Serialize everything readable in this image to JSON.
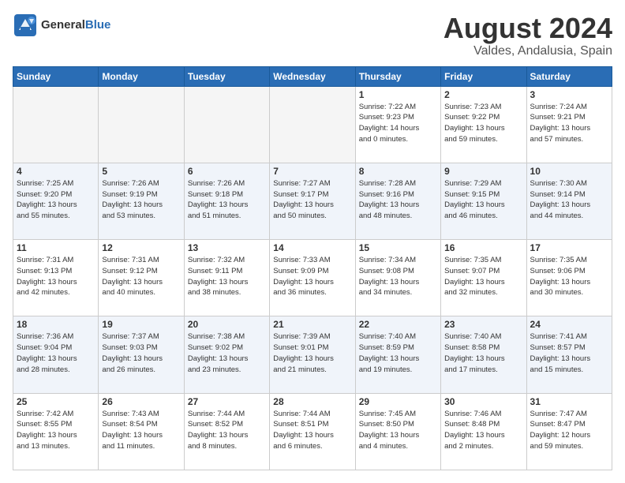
{
  "logo": {
    "text_general": "General",
    "text_blue": "Blue"
  },
  "header": {
    "month_title": "August 2024",
    "subtitle": "Valdes, Andalusia, Spain"
  },
  "weekdays": [
    "Sunday",
    "Monday",
    "Tuesday",
    "Wednesday",
    "Thursday",
    "Friday",
    "Saturday"
  ],
  "weeks": [
    [
      {
        "day": "",
        "info": "",
        "empty": true
      },
      {
        "day": "",
        "info": "",
        "empty": true
      },
      {
        "day": "",
        "info": "",
        "empty": true
      },
      {
        "day": "",
        "info": "",
        "empty": true
      },
      {
        "day": "1",
        "info": "Sunrise: 7:22 AM\nSunset: 9:23 PM\nDaylight: 14 hours\nand 0 minutes.",
        "empty": false
      },
      {
        "day": "2",
        "info": "Sunrise: 7:23 AM\nSunset: 9:22 PM\nDaylight: 13 hours\nand 59 minutes.",
        "empty": false
      },
      {
        "day": "3",
        "info": "Sunrise: 7:24 AM\nSunset: 9:21 PM\nDaylight: 13 hours\nand 57 minutes.",
        "empty": false
      }
    ],
    [
      {
        "day": "4",
        "info": "Sunrise: 7:25 AM\nSunset: 9:20 PM\nDaylight: 13 hours\nand 55 minutes.",
        "empty": false
      },
      {
        "day": "5",
        "info": "Sunrise: 7:26 AM\nSunset: 9:19 PM\nDaylight: 13 hours\nand 53 minutes.",
        "empty": false
      },
      {
        "day": "6",
        "info": "Sunrise: 7:26 AM\nSunset: 9:18 PM\nDaylight: 13 hours\nand 51 minutes.",
        "empty": false
      },
      {
        "day": "7",
        "info": "Sunrise: 7:27 AM\nSunset: 9:17 PM\nDaylight: 13 hours\nand 50 minutes.",
        "empty": false
      },
      {
        "day": "8",
        "info": "Sunrise: 7:28 AM\nSunset: 9:16 PM\nDaylight: 13 hours\nand 48 minutes.",
        "empty": false
      },
      {
        "day": "9",
        "info": "Sunrise: 7:29 AM\nSunset: 9:15 PM\nDaylight: 13 hours\nand 46 minutes.",
        "empty": false
      },
      {
        "day": "10",
        "info": "Sunrise: 7:30 AM\nSunset: 9:14 PM\nDaylight: 13 hours\nand 44 minutes.",
        "empty": false
      }
    ],
    [
      {
        "day": "11",
        "info": "Sunrise: 7:31 AM\nSunset: 9:13 PM\nDaylight: 13 hours\nand 42 minutes.",
        "empty": false
      },
      {
        "day": "12",
        "info": "Sunrise: 7:31 AM\nSunset: 9:12 PM\nDaylight: 13 hours\nand 40 minutes.",
        "empty": false
      },
      {
        "day": "13",
        "info": "Sunrise: 7:32 AM\nSunset: 9:11 PM\nDaylight: 13 hours\nand 38 minutes.",
        "empty": false
      },
      {
        "day": "14",
        "info": "Sunrise: 7:33 AM\nSunset: 9:09 PM\nDaylight: 13 hours\nand 36 minutes.",
        "empty": false
      },
      {
        "day": "15",
        "info": "Sunrise: 7:34 AM\nSunset: 9:08 PM\nDaylight: 13 hours\nand 34 minutes.",
        "empty": false
      },
      {
        "day": "16",
        "info": "Sunrise: 7:35 AM\nSunset: 9:07 PM\nDaylight: 13 hours\nand 32 minutes.",
        "empty": false
      },
      {
        "day": "17",
        "info": "Sunrise: 7:35 AM\nSunset: 9:06 PM\nDaylight: 13 hours\nand 30 minutes.",
        "empty": false
      }
    ],
    [
      {
        "day": "18",
        "info": "Sunrise: 7:36 AM\nSunset: 9:04 PM\nDaylight: 13 hours\nand 28 minutes.",
        "empty": false
      },
      {
        "day": "19",
        "info": "Sunrise: 7:37 AM\nSunset: 9:03 PM\nDaylight: 13 hours\nand 26 minutes.",
        "empty": false
      },
      {
        "day": "20",
        "info": "Sunrise: 7:38 AM\nSunset: 9:02 PM\nDaylight: 13 hours\nand 23 minutes.",
        "empty": false
      },
      {
        "day": "21",
        "info": "Sunrise: 7:39 AM\nSunset: 9:01 PM\nDaylight: 13 hours\nand 21 minutes.",
        "empty": false
      },
      {
        "day": "22",
        "info": "Sunrise: 7:40 AM\nSunset: 8:59 PM\nDaylight: 13 hours\nand 19 minutes.",
        "empty": false
      },
      {
        "day": "23",
        "info": "Sunrise: 7:40 AM\nSunset: 8:58 PM\nDaylight: 13 hours\nand 17 minutes.",
        "empty": false
      },
      {
        "day": "24",
        "info": "Sunrise: 7:41 AM\nSunset: 8:57 PM\nDaylight: 13 hours\nand 15 minutes.",
        "empty": false
      }
    ],
    [
      {
        "day": "25",
        "info": "Sunrise: 7:42 AM\nSunset: 8:55 PM\nDaylight: 13 hours\nand 13 minutes.",
        "empty": false
      },
      {
        "day": "26",
        "info": "Sunrise: 7:43 AM\nSunset: 8:54 PM\nDaylight: 13 hours\nand 11 minutes.",
        "empty": false
      },
      {
        "day": "27",
        "info": "Sunrise: 7:44 AM\nSunset: 8:52 PM\nDaylight: 13 hours\nand 8 minutes.",
        "empty": false
      },
      {
        "day": "28",
        "info": "Sunrise: 7:44 AM\nSunset: 8:51 PM\nDaylight: 13 hours\nand 6 minutes.",
        "empty": false
      },
      {
        "day": "29",
        "info": "Sunrise: 7:45 AM\nSunset: 8:50 PM\nDaylight: 13 hours\nand 4 minutes.",
        "empty": false
      },
      {
        "day": "30",
        "info": "Sunrise: 7:46 AM\nSunset: 8:48 PM\nDaylight: 13 hours\nand 2 minutes.",
        "empty": false
      },
      {
        "day": "31",
        "info": "Sunrise: 7:47 AM\nSunset: 8:47 PM\nDaylight: 12 hours\nand 59 minutes.",
        "empty": false
      }
    ]
  ]
}
